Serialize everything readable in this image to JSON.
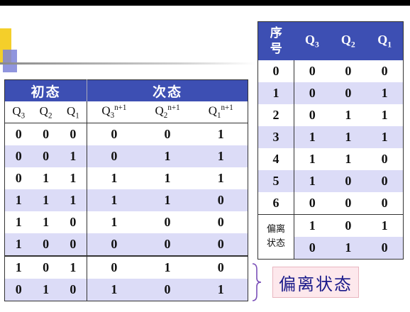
{
  "left_table": {
    "header_initial": "初态",
    "header_next": "次态",
    "sub_headers": [
      {
        "base": "Q",
        "sub": "3",
        "sup": ""
      },
      {
        "base": "Q",
        "sub": "2",
        "sup": ""
      },
      {
        "base": "Q",
        "sub": "1",
        "sup": ""
      },
      {
        "base": "Q",
        "sub": "3",
        "sup": "n+1"
      },
      {
        "base": "Q",
        "sub": "2",
        "sup": "n+1"
      },
      {
        "base": "Q",
        "sub": "1",
        "sup": "n+1"
      }
    ],
    "rows": [
      [
        "0",
        "0",
        "0",
        "0",
        "0",
        "1"
      ],
      [
        "0",
        "0",
        "1",
        "0",
        "1",
        "1"
      ],
      [
        "0",
        "1",
        "1",
        "1",
        "1",
        "1"
      ],
      [
        "1",
        "1",
        "1",
        "1",
        "1",
        "0"
      ],
      [
        "1",
        "1",
        "0",
        "1",
        "0",
        "0"
      ],
      [
        "1",
        "0",
        "0",
        "0",
        "0",
        "0"
      ],
      [
        "1",
        "0",
        "1",
        "0",
        "1",
        "0"
      ],
      [
        "0",
        "1",
        "0",
        "1",
        "0",
        "1"
      ]
    ]
  },
  "right_table": {
    "header_index_line1": "序",
    "header_index_line2": "号",
    "col_headers": [
      {
        "base": "Q",
        "sub": "3"
      },
      {
        "base": "Q",
        "sub": "2"
      },
      {
        "base": "Q",
        "sub": "1"
      }
    ],
    "rows": [
      [
        "0",
        "0",
        "0",
        "0"
      ],
      [
        "1",
        "0",
        "0",
        "1"
      ],
      [
        "2",
        "0",
        "1",
        "1"
      ],
      [
        "3",
        "1",
        "1",
        "1"
      ],
      [
        "4",
        "1",
        "1",
        "0"
      ],
      [
        "5",
        "1",
        "0",
        "0"
      ],
      [
        "6",
        "0",
        "0",
        "0"
      ]
    ],
    "invalid_label_line1": "偏离",
    "invalid_label_line2": "状态",
    "invalid_rows": [
      [
        "1",
        "0",
        "1"
      ],
      [
        "0",
        "1",
        "0"
      ]
    ]
  },
  "callout": "偏离状态",
  "colors": {
    "header_bg": "#3d4fb3",
    "row_alt": "#dcdcf7",
    "callout_bg": "#fde8ec"
  }
}
